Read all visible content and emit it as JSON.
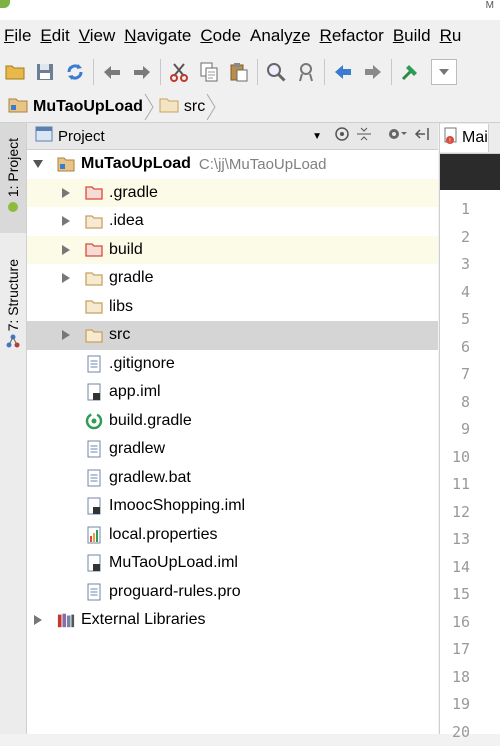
{
  "titlebar": {
    "text": "M"
  },
  "menu": [
    {
      "m": "F",
      "rest": "ile"
    },
    {
      "m": "E",
      "rest": "dit"
    },
    {
      "m": "V",
      "rest": "iew"
    },
    {
      "m": "N",
      "rest": "avigate"
    },
    {
      "m": "C",
      "rest": "ode"
    },
    {
      "pre": "Analy",
      "m": "z",
      "rest": "e"
    },
    {
      "m": "R",
      "rest": "efactor"
    },
    {
      "m": "B",
      "rest": "uild"
    },
    {
      "m": "R",
      "rest": "u"
    }
  ],
  "breadcrumb": {
    "project": "MuTaoUpLoad",
    "folder": "src"
  },
  "leftstrip": {
    "project_tab": "1: Project",
    "structure_tab": "7: Structure"
  },
  "panel": {
    "title": "Project"
  },
  "editor": {
    "tab_label": "Mai"
  },
  "tree": {
    "root_name": "MuTaoUpLoad",
    "root_path": "C:\\jj\\MuTaoUpLoad",
    "items": [
      {
        "name": ".gradle",
        "type": "folder-red"
      },
      {
        "name": ".idea",
        "type": "folder"
      },
      {
        "name": "build",
        "type": "folder-red"
      },
      {
        "name": "gradle",
        "type": "folder"
      },
      {
        "name": "libs",
        "type": "folder"
      },
      {
        "name": "src",
        "type": "folder"
      },
      {
        "name": ".gitignore",
        "type": "text-file"
      },
      {
        "name": "app.iml",
        "type": "iml-file"
      },
      {
        "name": "build.gradle",
        "type": "gradle-file"
      },
      {
        "name": "gradlew",
        "type": "text-file"
      },
      {
        "name": "gradlew.bat",
        "type": "text-file"
      },
      {
        "name": "ImoocShopping.iml",
        "type": "iml-file"
      },
      {
        "name": "local.properties",
        "type": "properties-file"
      },
      {
        "name": "MuTaoUpLoad.iml",
        "type": "iml-file"
      },
      {
        "name": "proguard-rules.pro",
        "type": "text-file"
      }
    ],
    "external": "External Libraries"
  },
  "line_numbers": [
    "1",
    "2",
    "3",
    "4",
    "5",
    "6",
    "7",
    "8",
    "9",
    "10",
    "11",
    "12",
    "13",
    "14",
    "15",
    "16",
    "17",
    "18",
    "19",
    "20"
  ],
  "colors": {
    "folder": "#c8a260",
    "folder_red": "#d94a3a",
    "highlight": "#fbfbe8",
    "selection": "#d5d5d5",
    "accent_blue": "#3c7bd0",
    "gradle_green": "#2e9b57"
  }
}
